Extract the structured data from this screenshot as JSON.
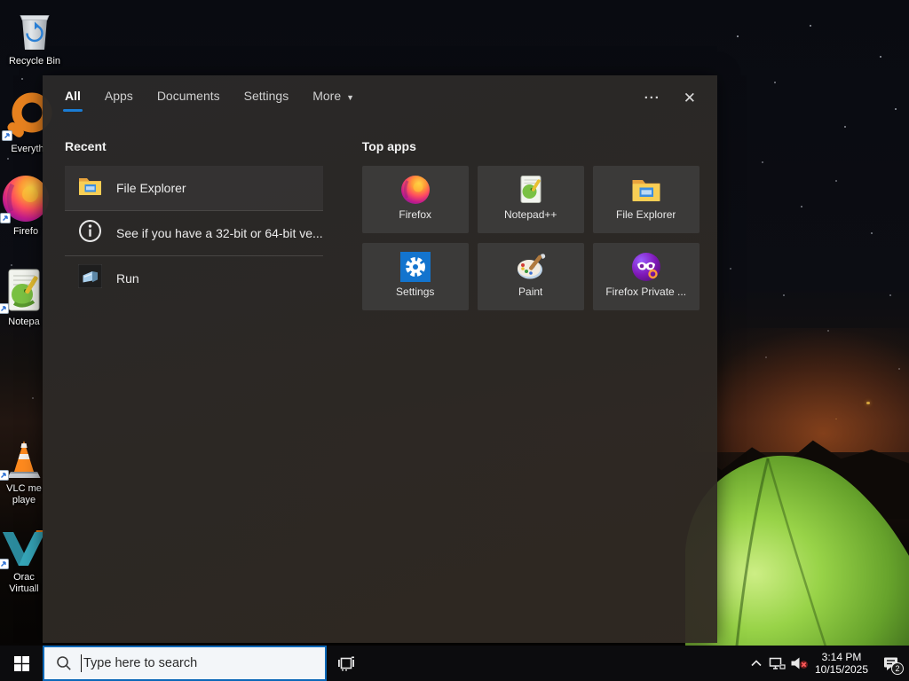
{
  "colors": {
    "accent": "#0078d7",
    "panel_bg": "#2b2a29",
    "tile_bg": "#3b3a39",
    "taskbar_bg": "#0c0c0e",
    "tent_green": "#8cc93e",
    "search_border": "#0b68b8"
  },
  "desktop": {
    "icons": [
      {
        "icon": "recycle-bin-icon",
        "label": "Recycle Bin"
      },
      {
        "icon": "everything-icon",
        "label": "Everyth"
      },
      {
        "icon": "firefox-icon",
        "label": "Firefo"
      },
      {
        "icon": "notepadpp-icon",
        "label": "Notepa"
      },
      {
        "icon": "vlc-icon",
        "label": "VLC me",
        "label2": "playe"
      },
      {
        "icon": "virtualbox-icon",
        "label": "Orac",
        "label2": "Virtuall"
      }
    ]
  },
  "search_panel": {
    "tabs": [
      {
        "label": "All",
        "active": true
      },
      {
        "label": "Apps",
        "active": false
      },
      {
        "label": "Documents",
        "active": false
      },
      {
        "label": "Settings",
        "active": false
      },
      {
        "label": "More",
        "active": false
      }
    ],
    "more_arrow": "▼",
    "actions": {
      "ellipsis": "···",
      "close": "✕"
    },
    "recent": {
      "header": "Recent",
      "items": [
        {
          "icon": "file-explorer-icon",
          "label": "File Explorer"
        },
        {
          "icon": "info-icon",
          "label": "See if you have a 32-bit or 64-bit ve..."
        },
        {
          "icon": "run-icon",
          "label": "Run"
        }
      ]
    },
    "top_apps": {
      "header": "Top apps",
      "items": [
        {
          "icon": "firefox-icon",
          "label": "Firefox"
        },
        {
          "icon": "notepadpp-icon",
          "label": "Notepad++"
        },
        {
          "icon": "file-explorer-icon",
          "label": "File Explorer"
        },
        {
          "icon": "settings-icon",
          "label": "Settings"
        },
        {
          "icon": "paint-icon",
          "label": "Paint"
        },
        {
          "icon": "firefox-private-icon",
          "label": "Firefox Private ..."
        }
      ]
    }
  },
  "taskbar": {
    "search_placeholder": "Type here to search",
    "tray": {
      "time": "3:14 PM",
      "date": "10/15/2025",
      "badge": "2"
    }
  }
}
